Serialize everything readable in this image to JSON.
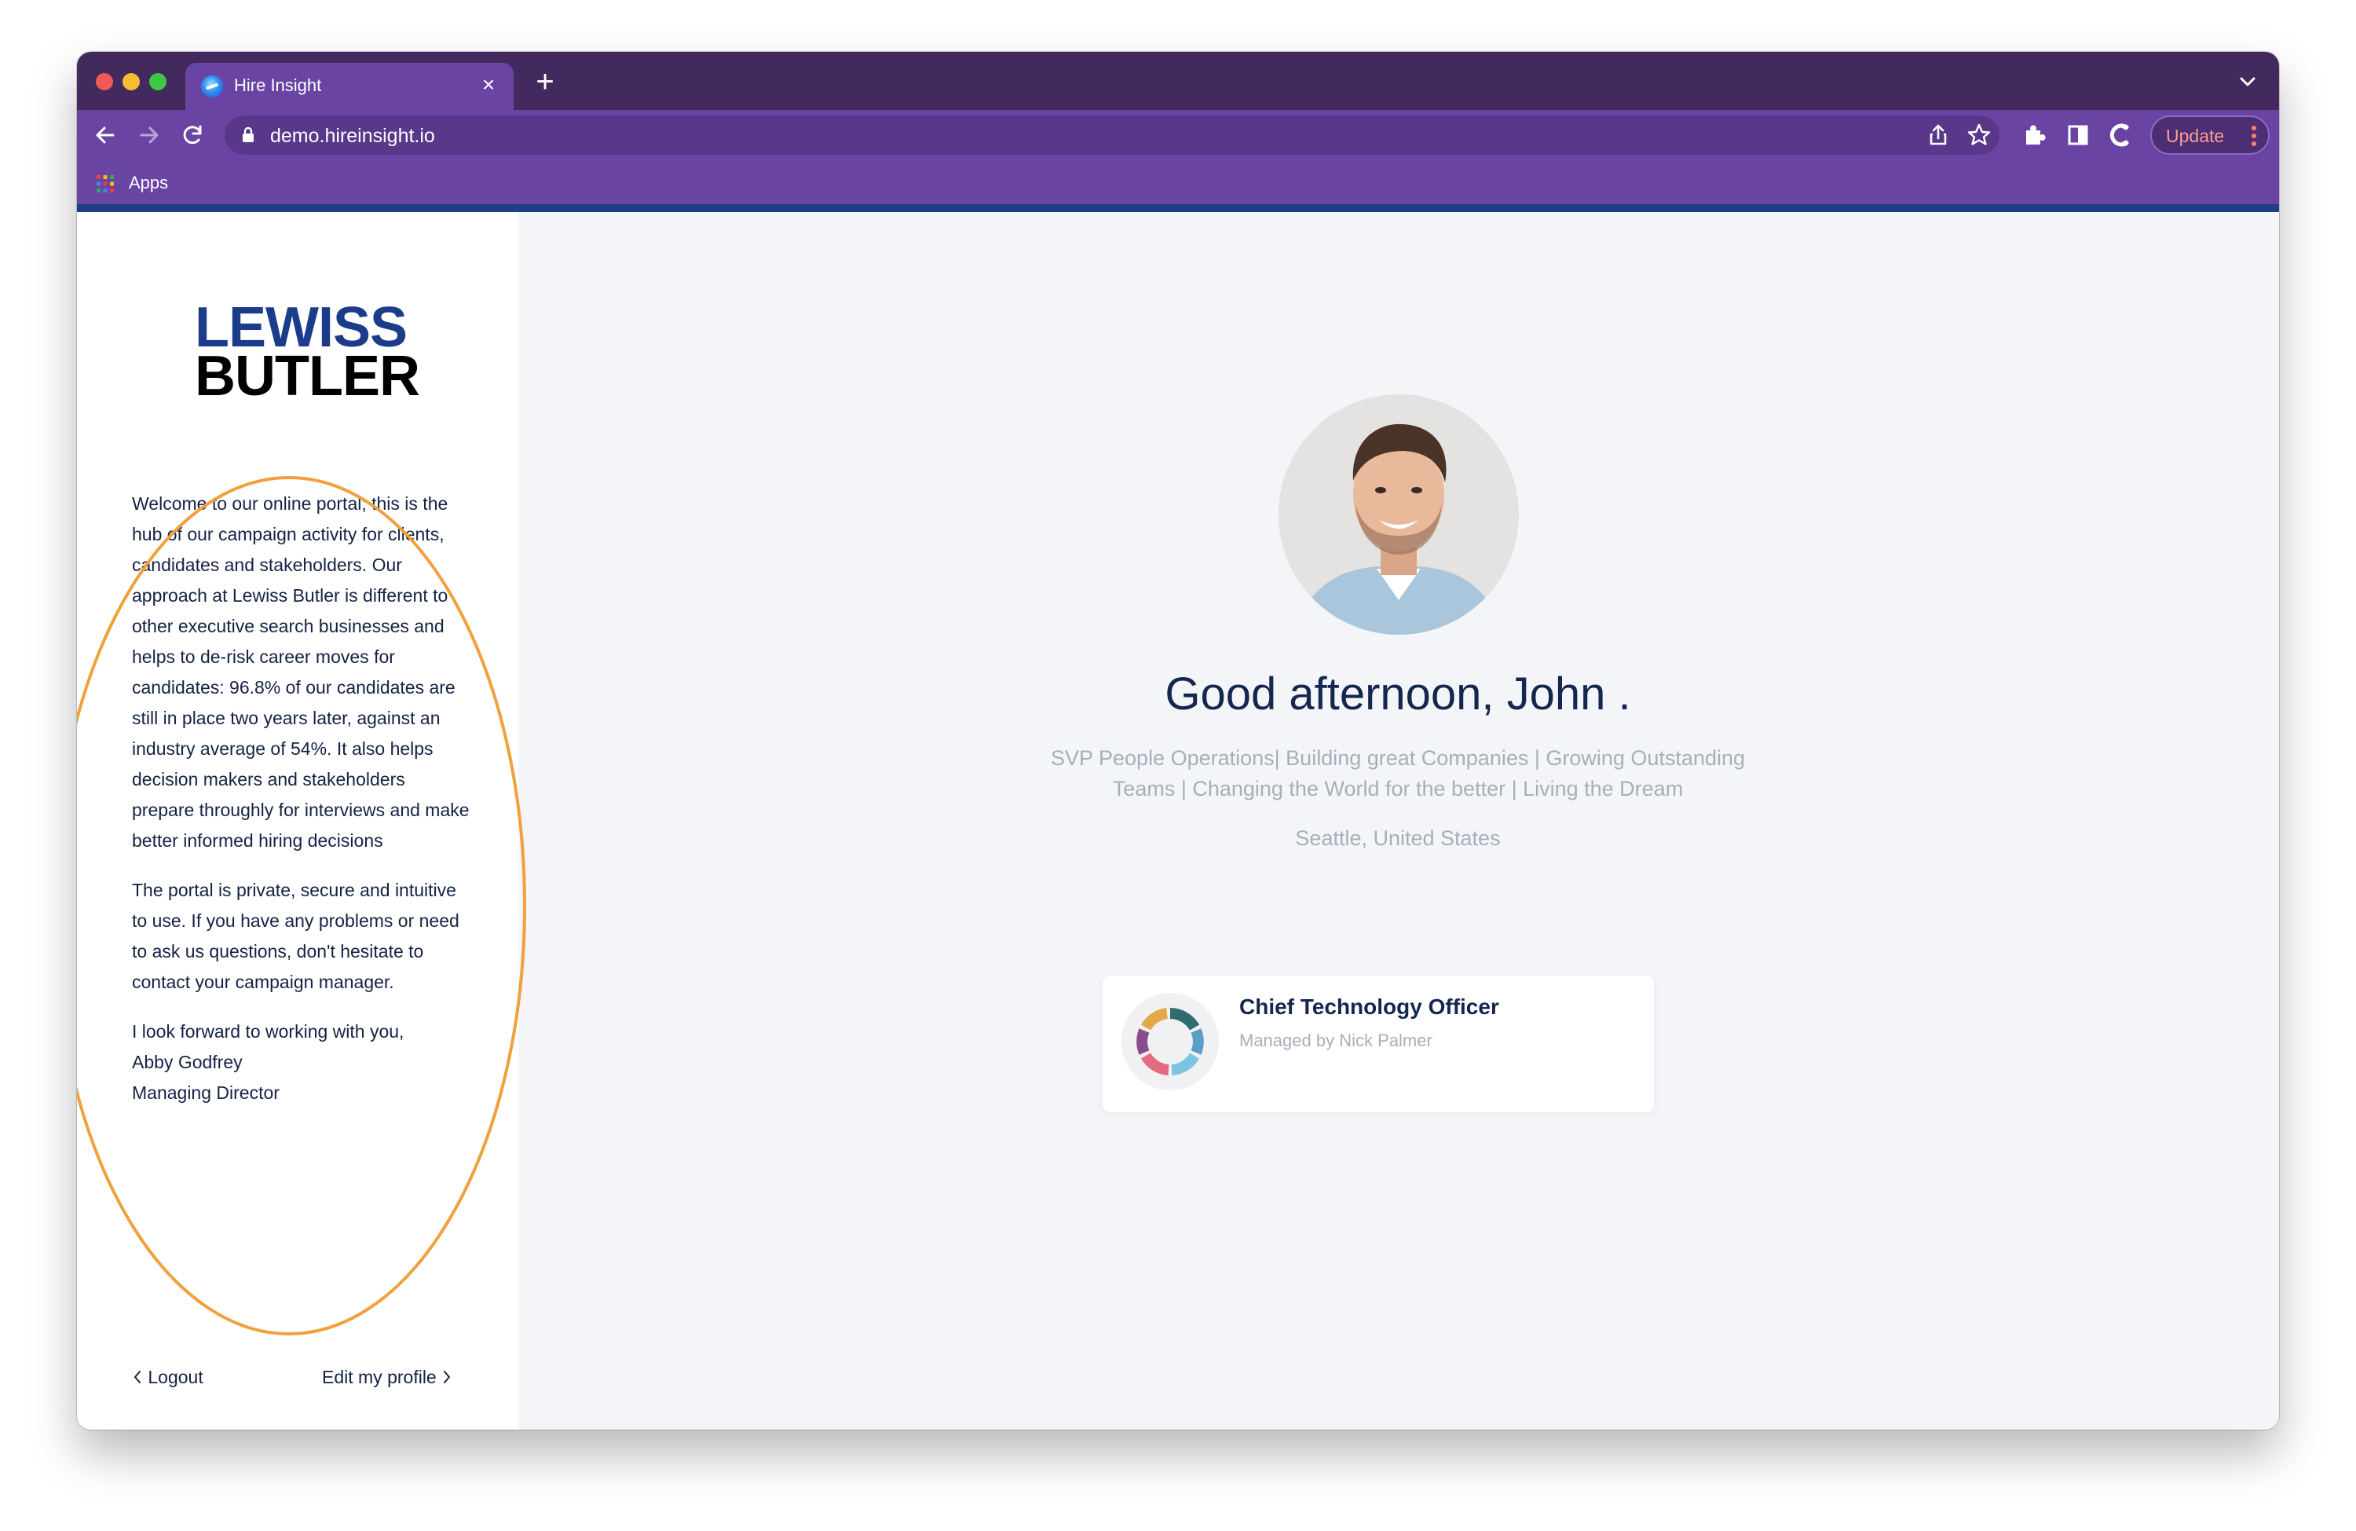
{
  "browser": {
    "tab_title": "Hire Insight",
    "url": "demo.hireinsight.io",
    "update_label": "Update",
    "bookmarks": [
      {
        "label": "Apps"
      }
    ]
  },
  "sidebar": {
    "logo": {
      "line1": "LEWISS",
      "line2": "BUTLER"
    },
    "intro_paragraphs": [
      "Welcome to our online portal; this is the hub of our campaign activity for clients, candidates and stakeholders. Our approach at Lewiss Butler is different to other executive search businesses and helps to de-risk career moves for candidates: 96.8% of our candidates are still in place two years later, against an industry average of 54%. It also helps decision makers and stakeholders prepare throughly for interviews and make better informed hiring decisions",
      "The portal is private, secure and intuitive to use. If you have any problems or need to ask us questions, don't hesitate to contact your campaign manager."
    ],
    "signoff": {
      "line1": "I look forward to working with you,",
      "name": "Abby Godfrey",
      "role": "Managing Director"
    },
    "logout_label": "Logout",
    "edit_profile_label": "Edit my profile"
  },
  "main": {
    "greeting": "Good afternoon, John .",
    "headline": "SVP People Operations| Building great Companies | Growing Outstanding Teams | Changing the World for the better | Living the Dream",
    "location": "Seattle, United States",
    "campaigns": [
      {
        "title": "Chief Technology Officer",
        "manager": "Managed by Nick Palmer"
      }
    ]
  },
  "colors": {
    "tabstrip": "#42295e",
    "toolbar": "#6a44a3",
    "brand_blue": "#1a3c8a",
    "annotation": "#f0a13c",
    "text_dark": "#15264f",
    "text_muted": "#a8aeb9"
  }
}
